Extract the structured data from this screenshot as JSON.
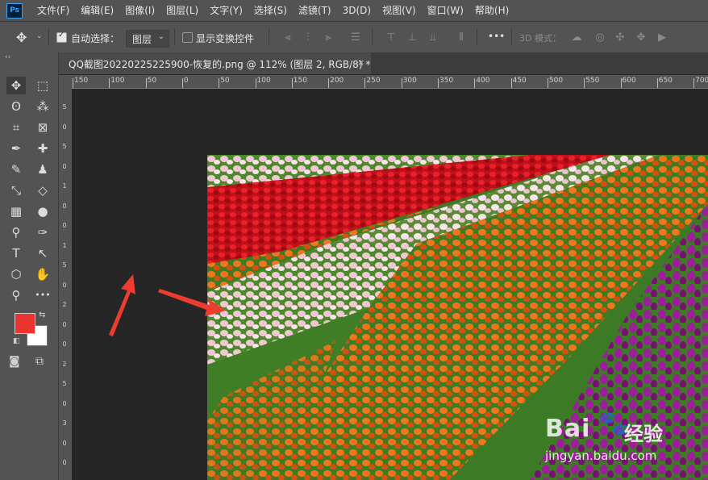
{
  "app": {
    "logo_text": "Ps"
  },
  "menu": [
    "文件(F)",
    "编辑(E)",
    "图像(I)",
    "图层(L)",
    "文字(Y)",
    "选择(S)",
    "滤镜(T)",
    "3D(D)",
    "视图(V)",
    "窗口(W)",
    "帮助(H)"
  ],
  "options": {
    "auto_select_label": "自动选择：",
    "auto_select_checked": true,
    "layer_select_value": "图层",
    "show_transform_label": "显示变换控件",
    "show_transform_checked": false,
    "more_label": "•••",
    "mode_3d_label": "3D 模式："
  },
  "document": {
    "tab_title": "QQ截图20220225225900-恢复的.png @ 112% (图层 2, RGB/8) *",
    "close_glyph": "×"
  },
  "ruler": {
    "top_ticks": [
      "150",
      "100",
      "50",
      "0",
      "50",
      "100",
      "150",
      "200",
      "250",
      "300",
      "350",
      "400",
      "450",
      "500",
      "550",
      "600",
      "650",
      "700"
    ],
    "left_ticks": [
      "5",
      "0",
      "5",
      "0",
      "1",
      "0",
      "0",
      "1",
      "5",
      "0",
      "2",
      "0",
      "0",
      "2",
      "5",
      "0",
      "3",
      "0",
      "0"
    ]
  },
  "colors": {
    "foreground": "#e8352f",
    "background": "#ffffff",
    "annotation_arrow": "#ee3d2e"
  },
  "tools": [
    {
      "name": "move",
      "glyph": "✥"
    },
    {
      "name": "marquee",
      "glyph": "⬚"
    },
    {
      "name": "lasso",
      "glyph": "ʘ"
    },
    {
      "name": "magic-wand",
      "glyph": "⁂"
    },
    {
      "name": "crop",
      "glyph": "⌗"
    },
    {
      "name": "frame",
      "glyph": "⊠"
    },
    {
      "name": "eyedropper",
      "glyph": "✒"
    },
    {
      "name": "healing",
      "glyph": "✚"
    },
    {
      "name": "brush",
      "glyph": "✎"
    },
    {
      "name": "stamp",
      "glyph": "♟"
    },
    {
      "name": "history-brush",
      "glyph": "⤡"
    },
    {
      "name": "eraser",
      "glyph": "◇"
    },
    {
      "name": "gradient",
      "glyph": "▦"
    },
    {
      "name": "blur",
      "glyph": "●"
    },
    {
      "name": "dodge",
      "glyph": "⚲"
    },
    {
      "name": "pen",
      "glyph": "✑"
    },
    {
      "name": "type",
      "glyph": "T"
    },
    {
      "name": "path-select",
      "glyph": "↖"
    },
    {
      "name": "shape",
      "glyph": "⬡"
    },
    {
      "name": "hand",
      "glyph": "✋"
    },
    {
      "name": "zoom",
      "glyph": "⚲"
    },
    {
      "name": "more",
      "glyph": "•••"
    }
  ],
  "watermark": {
    "brand": "Bai",
    "brand_cn": "经验",
    "url": "jingyan.baidu.com"
  }
}
